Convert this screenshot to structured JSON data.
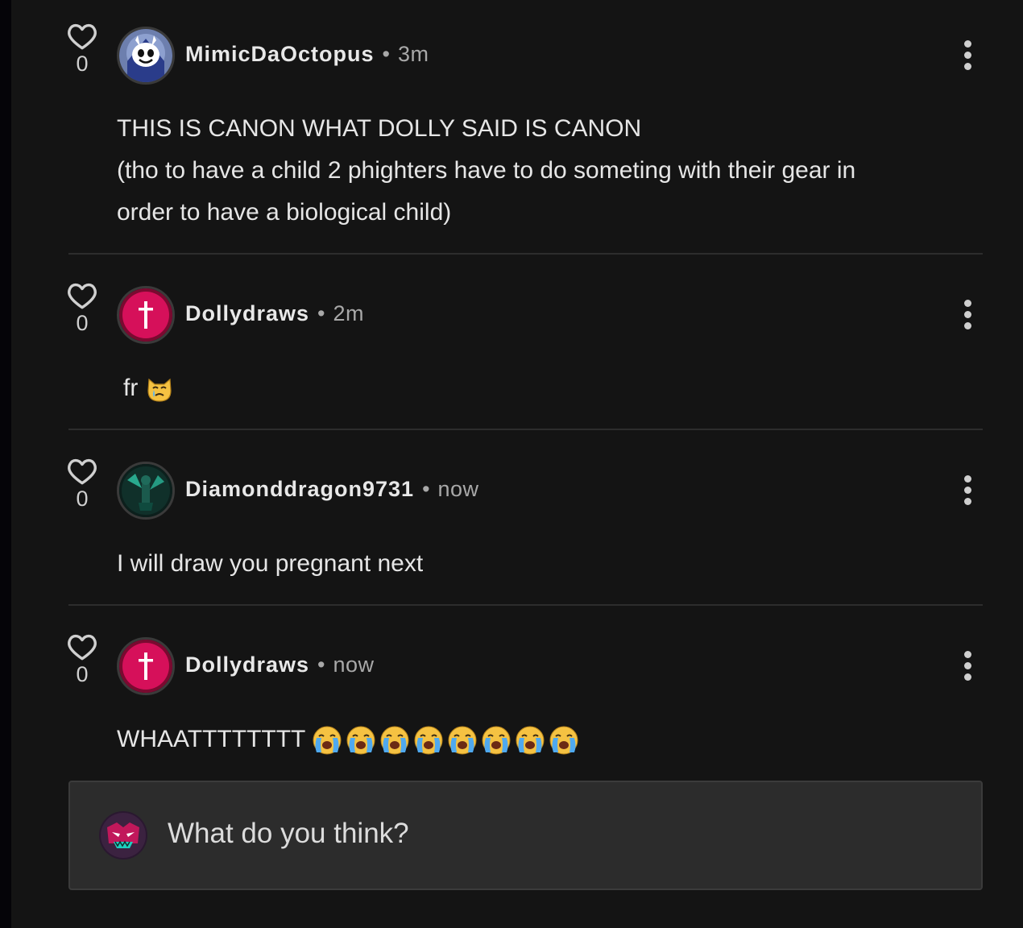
{
  "comments": [
    {
      "likes": "0",
      "username": "MimicDaOctopus",
      "separator": "•",
      "time": "3m",
      "lines": [
        "THIS IS CANON WHAT DOLLY SAID IS CANON",
        "(tho to have a child 2 phighters have to do someting with their gear in",
        "order to have a biological child)"
      ],
      "avatar_icon": "white-cartoon-mascot-avatar"
    },
    {
      "likes": "0",
      "username": "Dollydraws",
      "separator": "•",
      "time": "2m",
      "text": "fr",
      "emoji": "crying-cat-face",
      "avatar_icon": "pink-cross-avatar"
    },
    {
      "likes": "0",
      "username": "Diamonddragon9731",
      "separator": "•",
      "time": "now",
      "text": "I will draw you pregnant next",
      "avatar_icon": "teal-dragon-avatar"
    },
    {
      "likes": "0",
      "username": "Dollydraws",
      "separator": "•",
      "time": "now",
      "text": "WHAATTTTTTTT",
      "emoji": "loudly-crying-face",
      "emoji_count": 8,
      "avatar_icon": "pink-cross-avatar"
    }
  ],
  "composer": {
    "placeholder": "What do you think?",
    "avatar_icon": "pink-monster-avatar"
  },
  "colors": {
    "background": "#141414",
    "divider": "#2d2d2d",
    "input_bg": "#2c2c2c",
    "accent_pink": "#d6105a"
  }
}
